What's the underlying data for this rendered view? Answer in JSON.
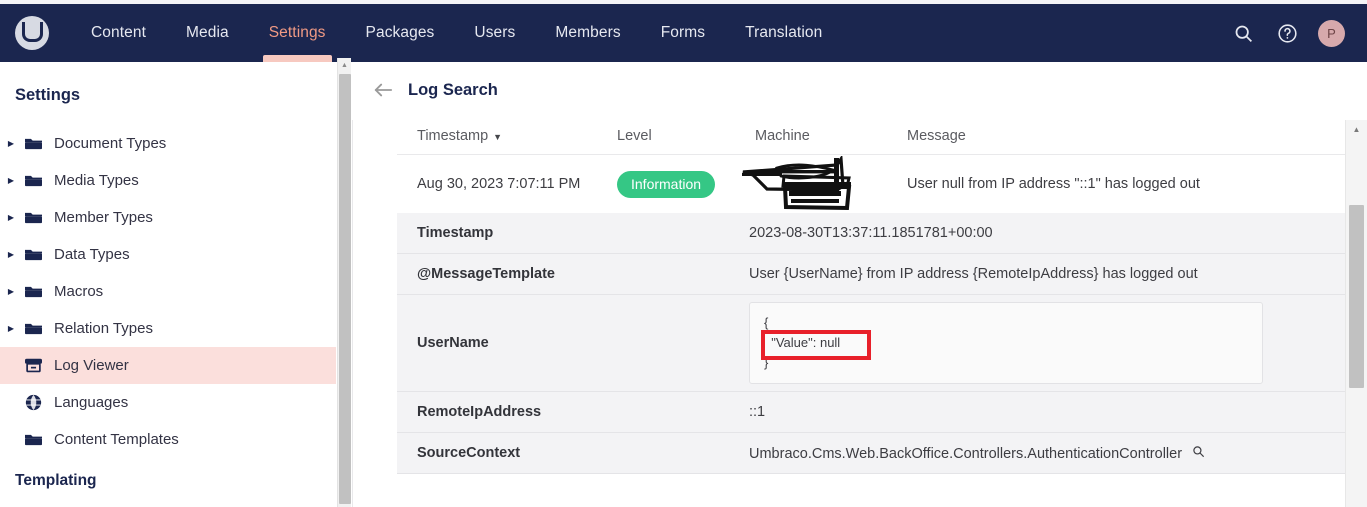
{
  "topnav": {
    "logo_alt": "Umbraco",
    "items": [
      {
        "label": "Content",
        "active": false
      },
      {
        "label": "Media",
        "active": false
      },
      {
        "label": "Settings",
        "active": true
      },
      {
        "label": "Packages",
        "active": false
      },
      {
        "label": "Users",
        "active": false
      },
      {
        "label": "Members",
        "active": false
      },
      {
        "label": "Forms",
        "active": false
      },
      {
        "label": "Translation",
        "active": false
      }
    ],
    "search_icon": "search-icon",
    "help_icon": "help-circle-icon",
    "avatar_initial": "P"
  },
  "sidebar": {
    "title": "Settings",
    "items": [
      {
        "label": "Document Types",
        "icon": "folder-icon",
        "expandable": true,
        "selected": false
      },
      {
        "label": "Media Types",
        "icon": "folder-icon",
        "expandable": true,
        "selected": false
      },
      {
        "label": "Member Types",
        "icon": "folder-icon",
        "expandable": true,
        "selected": false
      },
      {
        "label": "Data Types",
        "icon": "folder-icon",
        "expandable": true,
        "selected": false
      },
      {
        "label": "Macros",
        "icon": "folder-icon",
        "expandable": true,
        "selected": false
      },
      {
        "label": "Relation Types",
        "icon": "folder-icon",
        "expandable": true,
        "selected": false
      },
      {
        "label": "Log Viewer",
        "icon": "archive-icon",
        "expandable": false,
        "selected": true
      },
      {
        "label": "Languages",
        "icon": "globe-icon",
        "expandable": false,
        "selected": false
      },
      {
        "label": "Content Templates",
        "icon": "folder-icon",
        "expandable": false,
        "selected": false
      }
    ],
    "section_label": "Templating"
  },
  "main": {
    "back_icon": "back-arrow-icon",
    "title": "Log Search",
    "columns": {
      "timestamp": "Timestamp",
      "sort_caret": "▼",
      "level": "Level",
      "machine": "Machine",
      "message": "Message"
    },
    "log_entry": {
      "timestamp": "Aug 30, 2023 7:07:11 PM",
      "level": "Information",
      "level_color": "#35c785",
      "machine": "",
      "machine_redacted": true,
      "message": "User null from IP address \"::1\" has logged out"
    },
    "details": [
      {
        "key": "Timestamp",
        "value": "2023-08-30T13:37:11.1851781+00:00",
        "type": "text"
      },
      {
        "key": "@MessageTemplate",
        "value": "User {UserName} from IP address {RemoteIpAddress} has logged out",
        "type": "text"
      },
      {
        "key": "UserName",
        "type": "code",
        "code_lines": [
          "{",
          "  \"Value\": null",
          "}"
        ],
        "highlight": "\"Value\": null",
        "highlight_color": "#e8202a"
      },
      {
        "key": "RemoteIpAddress",
        "value": "::1",
        "type": "text"
      },
      {
        "key": "SourceContext",
        "value": "Umbraco.Cms.Web.BackOffice.Controllers.AuthenticationController",
        "type": "text",
        "trailing_icon": "search-icon"
      }
    ]
  },
  "scrollbars": {
    "sidebar_arrow": "▲",
    "main_arrow": "▲"
  }
}
